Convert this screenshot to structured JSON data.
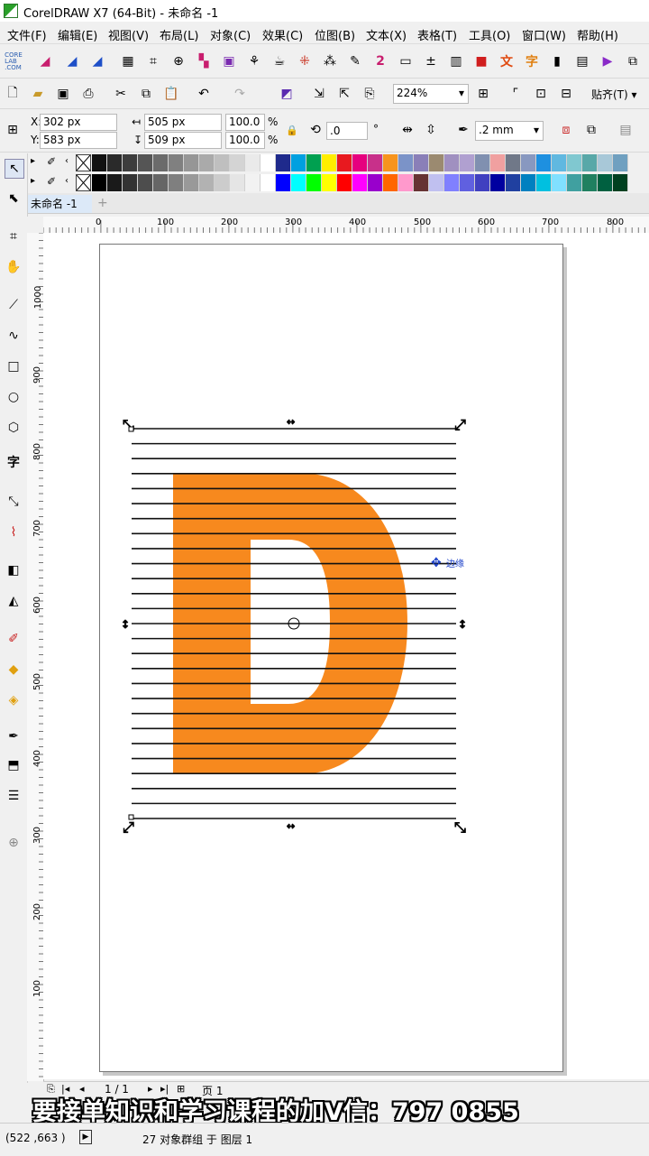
{
  "titlebar": {
    "title": "CorelDRAW X7 (64-Bit) - 未命名 -1"
  },
  "menu": [
    "文件(F)",
    "编辑(E)",
    "视图(V)",
    "布局(L)",
    "对象(C)",
    "效果(C)",
    "位图(B)",
    "文本(X)",
    "表格(T)",
    "工具(O)",
    "窗口(W)",
    "帮助(H)"
  ],
  "standard_toolbar": {
    "zoom": "224%",
    "snap_label": "贴齐(T)"
  },
  "property_bar": {
    "x_label": "X:",
    "x_value": "302 px",
    "y_label": "Y:",
    "y_value": "583 px",
    "width_value": "505 px",
    "height_value": "509 px",
    "scale_w": "100.0",
    "scale_h": "100.0",
    "percent": "%",
    "rotation": ".0",
    "degree": "°",
    "outline_width": ".2 mm"
  },
  "palette": {
    "row1": [
      "#111111",
      "#2a2a2a",
      "#3d3d3d",
      "#555555",
      "#6b6b6b",
      "#808080",
      "#969696",
      "#aaaaaa",
      "#bfbfbf",
      "#d4d4d4",
      "#eaeaea",
      "#ffffff",
      "#1f2a8c",
      "#00a0e0",
      "#00a050",
      "#ffee00",
      "#e8191f",
      "#e6007e",
      "#c8308a",
      "#f7941d",
      "#7b93c8",
      "#8a7fb8",
      "#9b8a70",
      "#a090c0",
      "#b0a0d0",
      "#8090b0",
      "#f0a0a0",
      "#707888",
      "#8898c0",
      "#1e90e0",
      "#60b8e0",
      "#80c8d0",
      "#58a8a8",
      "#a8c8d8",
      "#70a0c0"
    ],
    "row2": [
      "#000000",
      "#1a1a1a",
      "#333333",
      "#4d4d4d",
      "#666666",
      "#7f7f7f",
      "#999999",
      "#b2b2b2",
      "#cccccc",
      "#e5e5e5",
      "#f2f2f2",
      "#ffffff",
      "#0000ff",
      "#00ffff",
      "#00ff00",
      "#ffff00",
      "#ff0000",
      "#ff00ff",
      "#9900cc",
      "#ff6600",
      "#ff99cc",
      "#663333",
      "#c0c0f0",
      "#8080ff",
      "#6060e0",
      "#4040c0",
      "#0000a0",
      "#2040a0",
      "#0080c0",
      "#00c0e0",
      "#80e0ff",
      "#40a0a0",
      "#208060",
      "#006040",
      "#004020"
    ]
  },
  "document_tab": "未命名 -1",
  "ruler": {
    "h_ticks": [
      "0",
      "100",
      "200",
      "300",
      "400",
      "500",
      "600",
      "700",
      "800"
    ],
    "v_ticks": [
      "1000",
      "900",
      "800",
      "700",
      "600",
      "500",
      "400",
      "300",
      "200",
      "100"
    ]
  },
  "artwork": {
    "letter": "D",
    "letter_color": "#f7891e",
    "line_count": 27,
    "cursor_tooltip": "边缘"
  },
  "page_nav": {
    "page_count": "1 / 1",
    "page_tab": "页 1"
  },
  "overlay_text": "要接单知识和学习课程的加V信：797 0855",
  "status": {
    "coords": "(522 ,663 )",
    "message": "27 对象群组 于 图层 1"
  }
}
